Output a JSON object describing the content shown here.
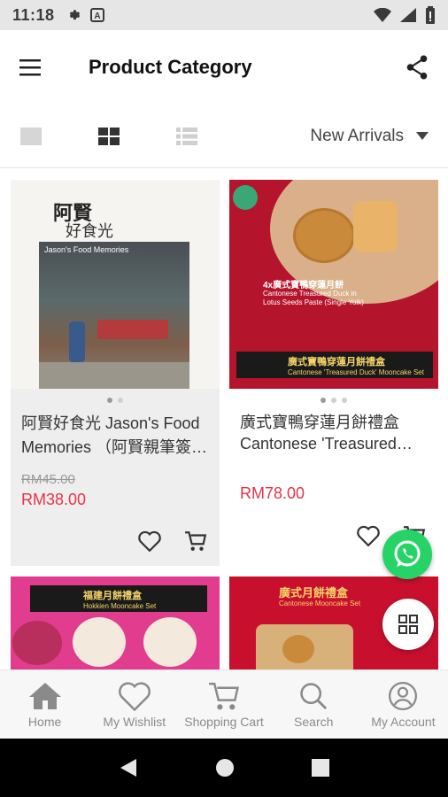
{
  "status_bar": {
    "time": "11:18",
    "icons": [
      "gear-icon",
      "a-icon",
      "wifi-icon",
      "signal-icon",
      "battery-icon"
    ]
  },
  "app_bar": {
    "title": "Product Category",
    "menu_icon": "menu-icon",
    "share_icon": "share-icon"
  },
  "toolbar": {
    "views": [
      "single-view-icon",
      "grid-view-icon",
      "list-view-icon"
    ],
    "active_view": "grid",
    "sort_label": "New Arrivals"
  },
  "products": [
    {
      "image_text": [
        "阿賢",
        "好食光",
        "Jason's Food Memories"
      ],
      "name": "阿賢好食光 Jason's Food Memories （阿賢親筆簽…",
      "old_price": "RM45.00",
      "price": "RM38.00"
    },
    {
      "image_text": [
        "4x廣式寶鴨穿蓮月餅",
        "Cantonese Treasured Duck in Lotus Seeds Paste (Single Yolk)",
        "廣式寶鴨穿蓮月餅禮盒",
        "Cantonese 'Treasured Duck' Mooncake Set"
      ],
      "name": "廣式寶鴨穿蓮月餅禮盒 Cantonese 'Treasured Duc…",
      "price": "RM78.00"
    },
    {
      "image_text": [
        "福建月餅禮盒",
        "Hokkien Mooncake Set"
      ]
    },
    {
      "image_text": [
        "廣式月餅禮盒",
        "Cantonese Mooncake Set"
      ]
    }
  ],
  "bottom_nav": [
    {
      "label": "Home",
      "icon": "home-icon"
    },
    {
      "label": "My Wishlist",
      "icon": "heart-icon"
    },
    {
      "label": "Shopping Cart",
      "icon": "cart-icon"
    },
    {
      "label": "Search",
      "icon": "search-icon"
    },
    {
      "label": "My Account",
      "icon": "account-icon"
    }
  ],
  "colors": {
    "price": "#e8334a",
    "selected_card": "#eeeeee",
    "whatsapp": "#25d366",
    "banner_red": "#c8102e",
    "banner_pink": "#e23c8e"
  }
}
